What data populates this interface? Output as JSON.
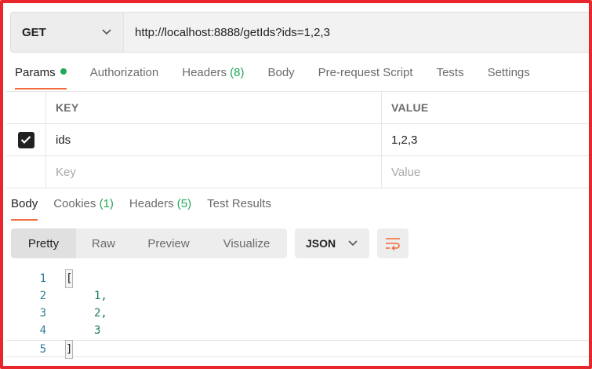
{
  "request": {
    "method": "GET",
    "url": "http://localhost:8888/getIds?ids=1,2,3"
  },
  "request_tabs": [
    {
      "label": "Params",
      "active": true
    },
    {
      "label": "Authorization"
    },
    {
      "label": "Headers",
      "count": "(8)"
    },
    {
      "label": "Body"
    },
    {
      "label": "Pre-request Script"
    },
    {
      "label": "Tests"
    },
    {
      "label": "Settings"
    }
  ],
  "params": {
    "headers": {
      "key": "KEY",
      "value": "VALUE"
    },
    "rows": [
      {
        "checked": true,
        "key": "ids",
        "value": "1,2,3"
      }
    ],
    "placeholder": {
      "key": "Key",
      "value": "Value"
    }
  },
  "response_tabs": [
    {
      "label": "Body",
      "active": true
    },
    {
      "label": "Cookies",
      "count": "(1)"
    },
    {
      "label": "Headers",
      "count": "(5)"
    },
    {
      "label": "Test Results"
    }
  ],
  "view_modes": [
    "Pretty",
    "Raw",
    "Preview",
    "Visualize"
  ],
  "format": "JSON",
  "code": {
    "line_numbers": [
      "1",
      "2",
      "3",
      "4",
      "5"
    ],
    "lines": [
      "[",
      "1,",
      "2,",
      "3",
      "]"
    ]
  },
  "colors": {
    "accent": "#f26b3a",
    "success": "#22a85a",
    "frame": "#e8262b"
  },
  "icons": [
    "chevron-down-icon",
    "checkmark-icon",
    "wrap-lines-icon"
  ]
}
